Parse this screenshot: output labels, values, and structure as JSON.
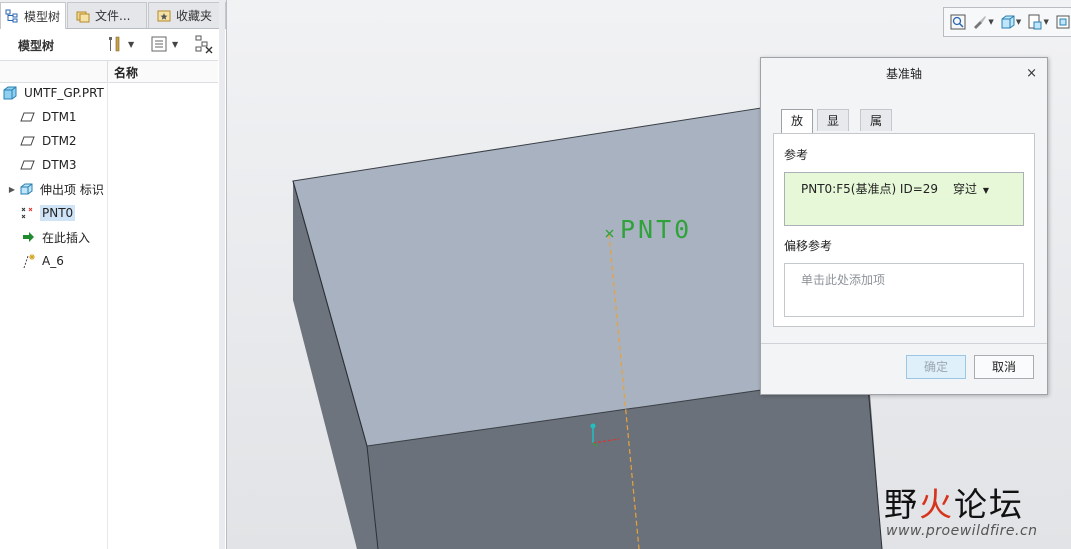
{
  "left_panel": {
    "tabs": [
      {
        "label": "模型树",
        "icon": "model-tree-icon"
      },
      {
        "label": "文件...",
        "icon": "folder-icon"
      },
      {
        "label": "收藏夹",
        "icon": "favorites-icon"
      }
    ],
    "toolbar_title": "模型树",
    "column_header": "名称",
    "tree": [
      {
        "label": "UMTF_GP.PRT",
        "icon": "part-icon"
      },
      {
        "label": "DTM1",
        "icon": "datum-plane-icon"
      },
      {
        "label": "DTM2",
        "icon": "datum-plane-icon"
      },
      {
        "label": "DTM3",
        "icon": "datum-plane-icon"
      },
      {
        "label": "伸出项 标识",
        "icon": "extrude-icon"
      },
      {
        "label": "PNT0",
        "icon": "datum-point-icon"
      },
      {
        "label": "在此插入",
        "icon": "insert-here-arrow-icon"
      },
      {
        "label": "A_6",
        "icon": "datum-axis-icon"
      }
    ]
  },
  "viewport": {
    "point_label": "PNT0"
  },
  "dialog": {
    "title": "基准轴",
    "tabs": [
      "放置",
      "显示",
      "属性"
    ],
    "active_tab": "放置",
    "reference_label": "参考",
    "reference_item": "PNT0:F5(基准点) ID=29",
    "reference_mode": "穿过",
    "offset_label": "偏移参考",
    "offset_placeholder": "单击此处添加项",
    "ok_label": "确定",
    "cancel_label": "取消",
    "close_symbol": "×"
  },
  "watermark": {
    "text_part1": "野",
    "text_part2": "火",
    "text_part3": "论坛",
    "url": "www.proewildfire.cn"
  },
  "colors": {
    "face_top": "#a8b2c1",
    "face_side": "#6b717a",
    "reference_bg": "#e7f8d8",
    "point_green": "#2fa33a",
    "axis_orange": "#e7a23a"
  }
}
